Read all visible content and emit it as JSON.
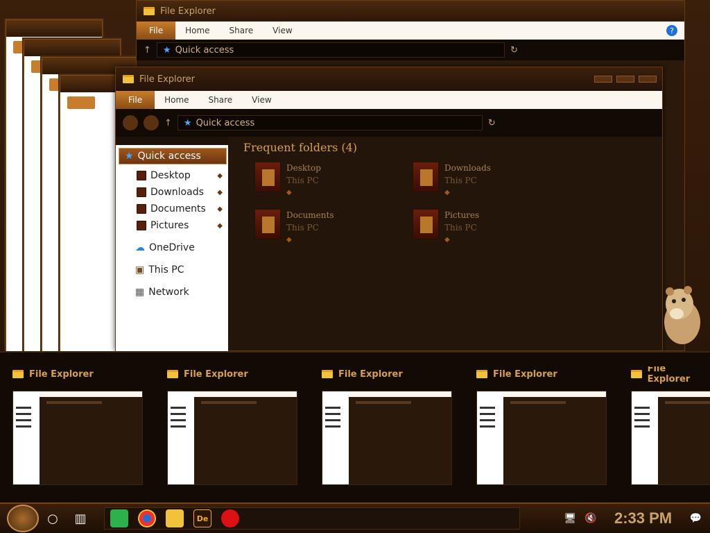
{
  "window": {
    "title": "File Explorer",
    "ribbon_tabs": {
      "file": "File",
      "home": "Home",
      "share": "Share",
      "view": "View"
    },
    "help": "?",
    "address": "Quick access"
  },
  "nav": {
    "quick_access": "Quick access",
    "items": [
      {
        "label": "Desktop"
      },
      {
        "label": "Downloads"
      },
      {
        "label": "Documents"
      },
      {
        "label": "Pictures"
      }
    ],
    "onedrive": "OneDrive",
    "thispc": "This PC",
    "network": "Network"
  },
  "content": {
    "section_title": "Frequent folders (4)",
    "folders": [
      {
        "name": "Desktop",
        "location": "This PC"
      },
      {
        "name": "Downloads",
        "location": "This PC"
      },
      {
        "name": "Documents",
        "location": "This PC"
      },
      {
        "name": "Pictures",
        "location": "This PC"
      }
    ]
  },
  "taskview": {
    "cards": [
      {
        "title": "File Explorer"
      },
      {
        "title": "File Explorer"
      },
      {
        "title": "File Explorer"
      },
      {
        "title": "File Explorer"
      },
      {
        "title": "File Explorer"
      }
    ]
  },
  "taskbar": {
    "apps": [
      "Notes",
      "Chrome",
      "File Explorer",
      "De",
      "App"
    ],
    "clock": "2:33 PM"
  },
  "colors": {
    "accent": "#c77d2b",
    "nav_bg": "#ffffff",
    "content_bg": "#231509",
    "taskbar_bg": "#1c0e05"
  }
}
